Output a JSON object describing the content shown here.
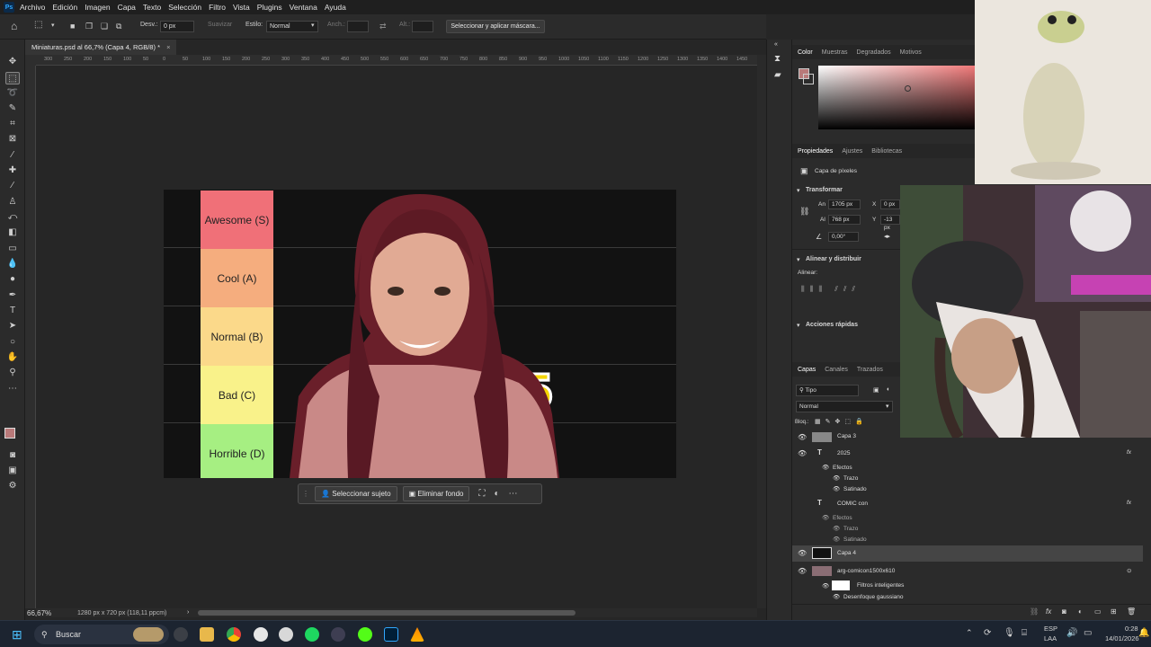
{
  "menu": {
    "items": [
      "Archivo",
      "Edición",
      "Imagen",
      "Capa",
      "Texto",
      "Selección",
      "Filtro",
      "Vista",
      "Plugins",
      "Ventana",
      "Ayuda"
    ]
  },
  "options": {
    "desv_label": "Desv.:",
    "desv_value": "0 px",
    "suavizar": "Suavizar",
    "estilo_label": "Estilo:",
    "estilo_value": "Normal",
    "ancho_label": "Anch.:",
    "alt_label": "Alt.:",
    "mask_button": "Seleccionar y aplicar máscara..."
  },
  "document": {
    "tab_title": "Miniaturas.psd al 66,7% (Capa 4, RGB/8) *",
    "zoom": "66,67%",
    "doc_info": "1280 px x 720 px (118,11 ppcm)",
    "ruler_ticks": [
      "300",
      "250",
      "200",
      "150",
      "100",
      "50",
      "0",
      "50",
      "100",
      "150",
      "200",
      "250",
      "300",
      "350",
      "400",
      "450",
      "500",
      "550",
      "600",
      "650",
      "700",
      "750",
      "800",
      "850",
      "900",
      "950",
      "1000",
      "1050",
      "1100",
      "1150",
      "1200",
      "1250",
      "1300",
      "1350",
      "1400",
      "1450"
    ]
  },
  "artwork": {
    "tiers": [
      {
        "label": "Awesome (S)",
        "color": "#f07078"
      },
      {
        "label": "Cool (A)",
        "color": "#f5ad7e"
      },
      {
        "label": "Normal (B)",
        "color": "#fbd98a"
      },
      {
        "label": "Bad (C)",
        "color": "#f9f28a"
      },
      {
        "label": "Horrible (D)",
        "color": "#a6ef82"
      }
    ],
    "overlay_text": "25"
  },
  "context_bar": {
    "select_subject": "Seleccionar sujeto",
    "remove_bg": "Eliminar fondo"
  },
  "color_panel": {
    "tabs": [
      "Color",
      "Muestras",
      "Degradados",
      "Motivos"
    ],
    "foreground": "#b97a7a"
  },
  "properties_panel": {
    "tabs": [
      "Propiedades",
      "Ajustes",
      "Bibliotecas"
    ],
    "layer_type": "Capa de píxeles",
    "transform_title": "Transformar",
    "an_label": "An",
    "an_value": "1705 px",
    "x_label": "X",
    "x_value": "0 px",
    "al_label": "Al",
    "al_value": "768 px",
    "y_label": "Y",
    "y_value": "-13 px",
    "angle_value": "0,00°",
    "align_title": "Alinear y distribuir",
    "align_label": "Alinear:",
    "quick_title": "Acciones rápidas"
  },
  "layers_panel": {
    "tabs": [
      "Capas",
      "Canales",
      "Trazados"
    ],
    "filter": "Tipo",
    "blend_mode": "Normal",
    "lock_label": "Bloq.:",
    "layers": {
      "capa3": "Capa 3",
      "t2025": "2025",
      "t2025_fx": "Efectos",
      "t2025_trazo": "Trazo",
      "t2025_satinado": "Satinado",
      "comic": "COMIC con",
      "comic_fx": "Efectos",
      "comic_trazo": "Trazo",
      "comic_satinado": "Satinado",
      "capa4": "Capa 4",
      "arg": "arg-comicon1500x610",
      "filtros": "Filtros inteligentes",
      "desenfoque": "Desenfoque gaussiano"
    }
  },
  "taskbar": {
    "search": "Buscar",
    "lang_top": "ESP",
    "lang_bottom": "LAA",
    "time": "0:28",
    "date": "14/01/2026"
  }
}
